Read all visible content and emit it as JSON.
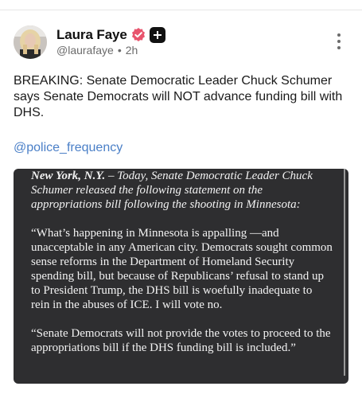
{
  "author": {
    "display_name": "Laura Faye",
    "handle": "@laurafaye",
    "time_ago": "2h",
    "verified_icon": "verified-badge-icon",
    "plus_icon": "plus-badge-icon"
  },
  "post": {
    "text": "BREAKING: Senate Democratic Leader Chuck Schumer says Senate Democrats will NOT advance funding bill with DHS.",
    "mention": "@police_frequency"
  },
  "media": {
    "dateline_place": "New York, N.Y.",
    "dateline_rest": " – Today, Senate Democratic Leader Chuck Schumer released the following statement on the appropriations bill following the shooting in Minnesota:",
    "paragraph_1": "“What’s happening in Minnesota is appalling —and unacceptable in any American city. Democrats sought common sense reforms in the Department of Homeland Security spending bill, but because of Republicans’ refusal to stand up to President Trump, the DHS bill is woefully inadequate to rein in the abuses of ICE. I will vote no.",
    "paragraph_2": "“Senate Democrats will not provide the votes to proceed to the appropriations bill if the DHS funding bill is included.”"
  },
  "colors": {
    "verified": "#e8546d",
    "link": "#4a7fc7",
    "media_bg": "#2e2e30"
  }
}
